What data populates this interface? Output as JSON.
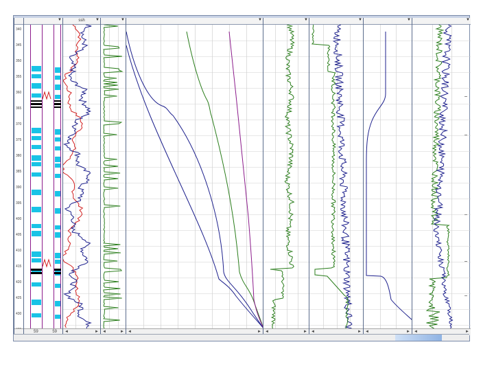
{
  "tracks": [
    {
      "title": "",
      "kind": "depth"
    },
    {
      "title": "",
      "kind": "lithology"
    },
    {
      "title": "ssh",
      "kind": "ssh"
    },
    {
      "title": "",
      "kind": "gr"
    },
    {
      "title": "",
      "kind": "pressure"
    },
    {
      "title": "",
      "kind": "res1"
    },
    {
      "title": "",
      "kind": "res2"
    },
    {
      "title": "",
      "kind": "temp"
    },
    {
      "title": "",
      "kind": "logs"
    }
  ],
  "depth_labels": [
    "340",
    "345",
    "350",
    "355",
    "360",
    "365",
    "370",
    "375",
    "380",
    "385",
    "390",
    "395",
    "400",
    "405",
    "410",
    "415",
    "420",
    "425",
    "430",
    "435"
  ],
  "lithology": {
    "marker_left": "59",
    "marker_right": "59"
  },
  "status": {
    "left": "",
    "right": "",
    "logo": ""
  },
  "scroll": {
    "left_arrow": "◄",
    "right_arrow": "►"
  },
  "dropdown_glyph": "▼",
  "colors": {
    "red": "#d21f1f",
    "blue": "#1c1f8c",
    "green": "#2a7d1b",
    "purple": "#8b1a8b",
    "cyan": "#19c3e6",
    "black": "#000000"
  }
}
